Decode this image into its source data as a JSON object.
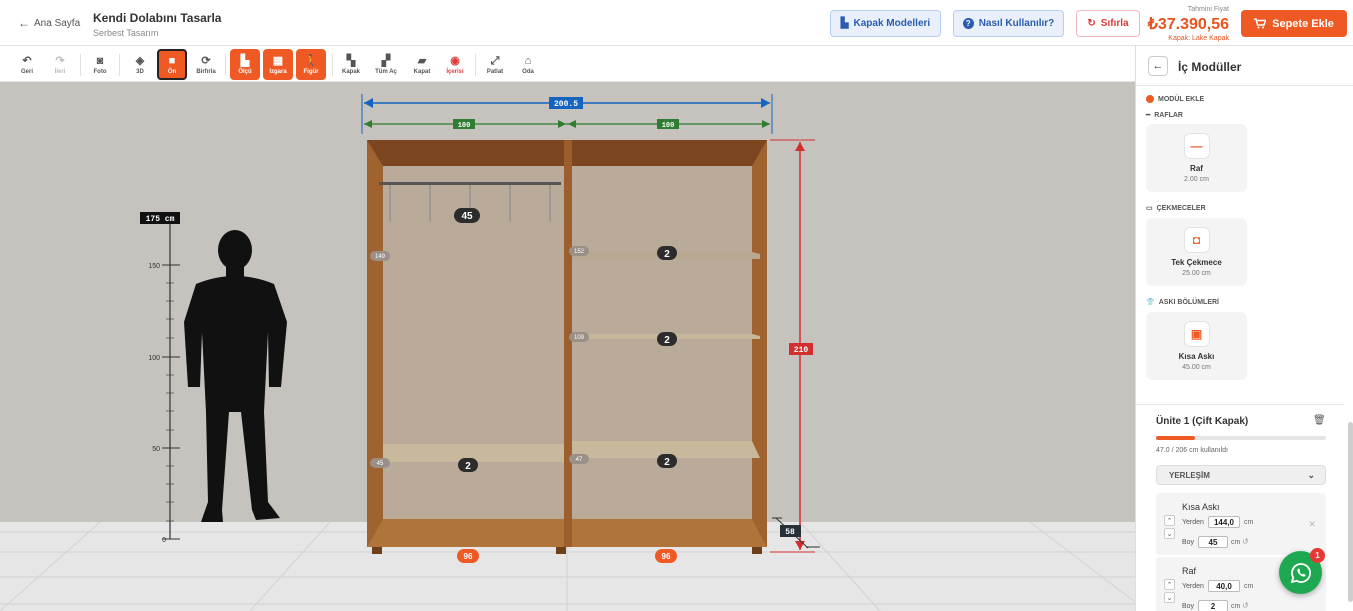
{
  "header": {
    "back_label": "Ana Sayfa",
    "title": "Kendi Dolabını Tasarla",
    "subtitle": "Serbest Tasarım",
    "kapak_button": "Kapak Modelleri",
    "help_button": "Nasıl Kullanılır?",
    "reset_button": "Sıfırla",
    "price_label": "Tahmini Fiyat",
    "price_value": "₺37.390,56",
    "price_sub": "Kapak: Lake Kapak",
    "cart_button": "Sepete Ekle",
    "colors": {
      "accent": "#ef5a24",
      "blue": "#2a5db0"
    }
  },
  "toolbar": {
    "undo": "Geri",
    "redo": "İleri",
    "photo": "Foto",
    "view3d": "3D",
    "front": "Ön",
    "rotate": "Birfırla",
    "measure": "Ölçü",
    "grid": "Izgara",
    "figure": "Figür",
    "door": "Kapak",
    "open_all": "Tüm Aç",
    "close": "Kapat",
    "inside": "İçerisi",
    "explode": "Patlat",
    "room": "Oda"
  },
  "scene": {
    "total_width": "200.5",
    "left_width": "100",
    "right_width": "100",
    "height": "210",
    "depth": "58",
    "human_height": "175 cm",
    "ruler_ticks": [
      "150",
      "100",
      "50",
      "0"
    ],
    "hanger_width": "45",
    "left_labels": [
      "149",
      "45"
    ],
    "right_labels": [
      "152",
      "109",
      "47"
    ],
    "shelf_counts": [
      "2",
      "2",
      "2",
      "2"
    ],
    "bottom_left": "96",
    "bottom_right": "96"
  },
  "panel": {
    "title": "İç Modüller",
    "add_module": "MODÜL EKLE",
    "sec_shelves": "RAFLAR",
    "sec_drawers": "ÇEKMECELER",
    "sec_hangers": "ASKI BÖLÜMLERİ",
    "card_shelf": {
      "name": "Raf",
      "size": "2.00 cm"
    },
    "card_drawer": {
      "name": "Tek Çekmece",
      "size": "25.00 cm"
    },
    "card_hanger": {
      "name": "Kısa Askı",
      "size": "45.00 cm"
    },
    "unit_title": "Ünite 1 (Çift Kapak)",
    "unit_usage": "47.0 / 206 cm kullanıldı",
    "unit_progress": 0.228,
    "placement": "YERLEŞİM",
    "item1": {
      "name": "Kısa Askı",
      "from_label": "Yerden",
      "from_value": "144,0",
      "size_label": "Boy",
      "size_value": "45",
      "unit": "cm"
    },
    "item2": {
      "name": "Raf",
      "from_label": "Yerden",
      "from_value": "40,0",
      "size_label": "Boy",
      "size_value": "2",
      "unit": "cm"
    },
    "whatsapp_badge": "1"
  }
}
